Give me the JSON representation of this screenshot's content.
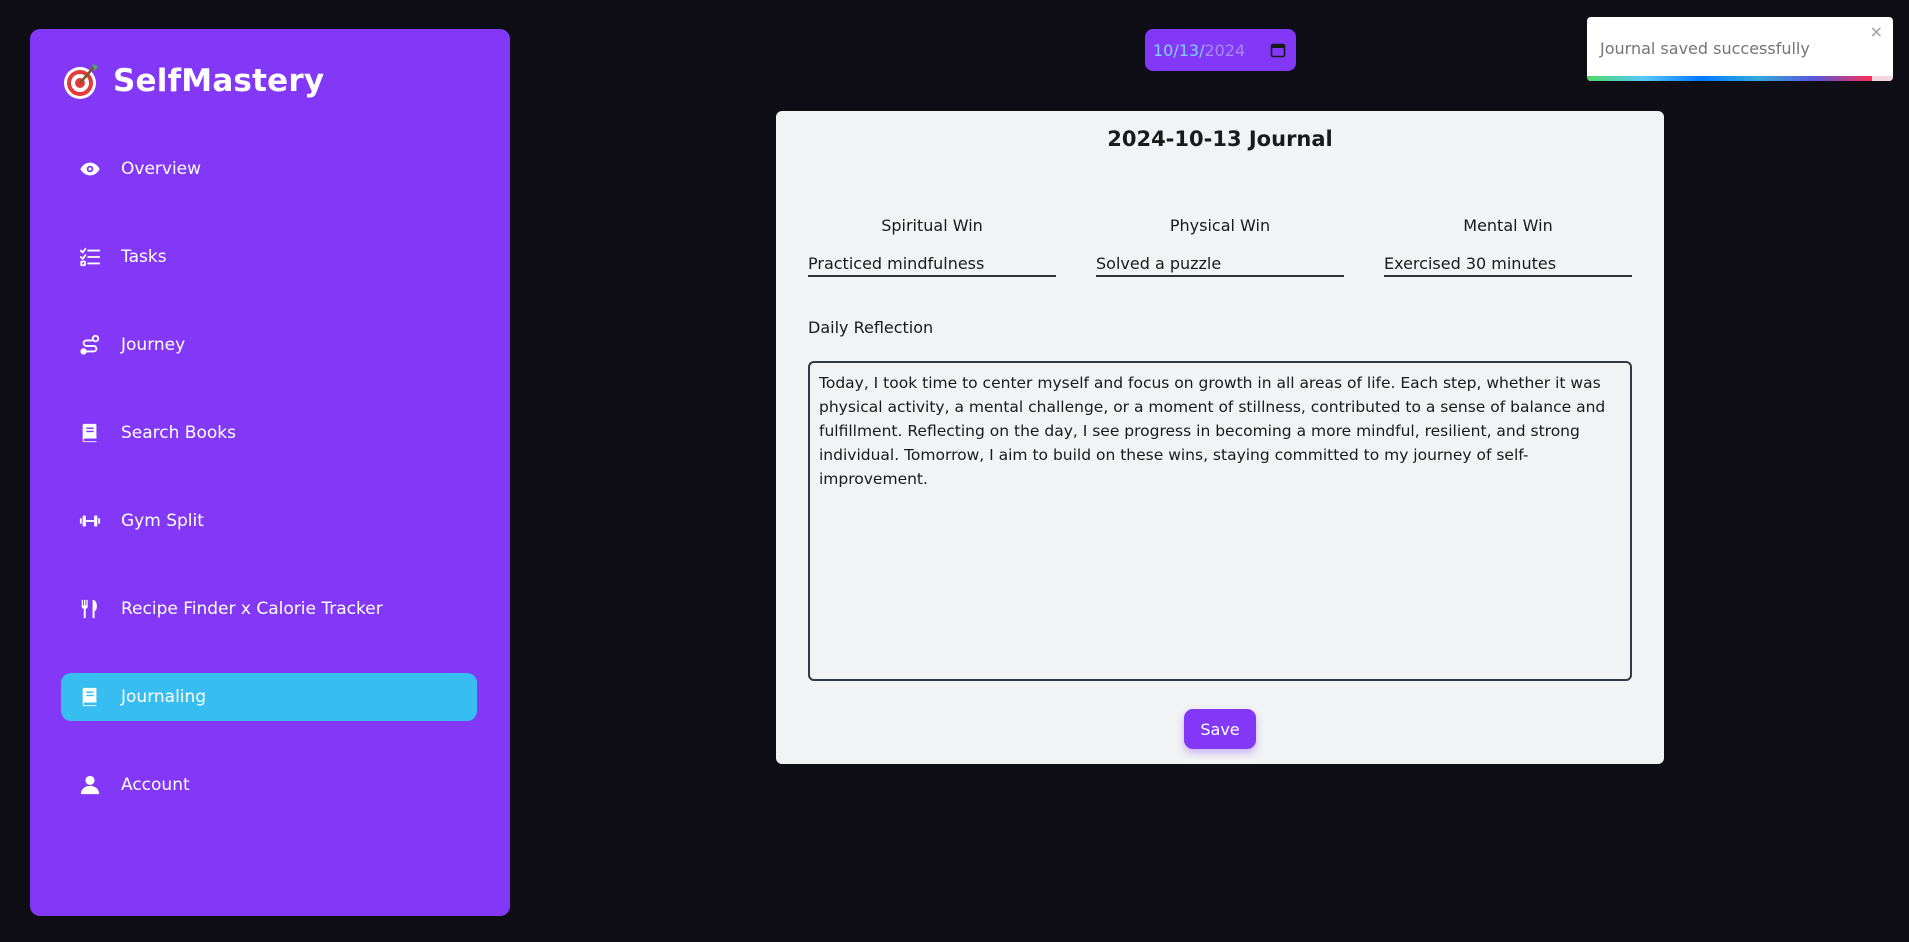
{
  "brand": {
    "name": "SelfMastery",
    "logo_icon": "target-arrow-icon"
  },
  "nav": {
    "items": [
      {
        "label": "Overview",
        "icon": "eye-icon",
        "active": false
      },
      {
        "label": "Tasks",
        "icon": "checklist-icon",
        "active": false
      },
      {
        "label": "Journey",
        "icon": "route-icon",
        "active": false
      },
      {
        "label": "Search Books",
        "icon": "book-icon",
        "active": false
      },
      {
        "label": "Gym Split",
        "icon": "dumbbell-icon",
        "active": false
      },
      {
        "label": "Recipe Finder x Calorie Tracker",
        "icon": "utensils-icon",
        "active": false
      },
      {
        "label": "Journaling",
        "icon": "journal-icon",
        "active": true
      },
      {
        "label": "Account",
        "icon": "user-icon",
        "active": false
      }
    ]
  },
  "date_picker": {
    "month_day": "10/13",
    "separator": "/",
    "year": "2024"
  },
  "toast": {
    "message": "Journal saved successfully",
    "close": "×"
  },
  "journal": {
    "title": "2024-10-13 Journal",
    "wins": {
      "spiritual": {
        "label": "Spiritual Win",
        "value": "Practiced mindfulness"
      },
      "physical": {
        "label": "Physical Win",
        "value": "Solved a puzzle"
      },
      "mental": {
        "label": "Mental Win",
        "value": "Exercised 30 minutes"
      }
    },
    "reflection_label": "Daily Reflection",
    "reflection": "Today, I took time to center myself and focus on growth in all areas of life. Each step, whether it was physical activity, a mental challenge, or a moment of stillness, contributed to a sense of balance and fulfillment. Reflecting on the day, I see progress in becoming a more mindful, resilient, and strong individual. Tomorrow, I aim to build on these wins, staying committed to my journey of self-improvement.",
    "save_label": "Save"
  },
  "colors": {
    "background": "#0f0e17",
    "accent": "#8338f7",
    "active_nav": "#38bdf0",
    "card": "#f1f3f4"
  }
}
